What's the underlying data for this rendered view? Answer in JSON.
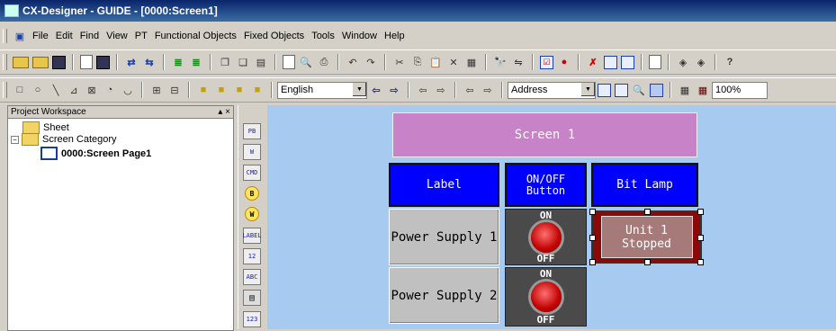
{
  "window": {
    "title": "CX-Designer - GUIDE - [0000:Screen1]"
  },
  "menu": [
    "File",
    "Edit",
    "Find",
    "View",
    "PT",
    "Functional Objects",
    "Fixed Objects",
    "Tools",
    "Window",
    "Help"
  ],
  "toolbar2": {
    "language_value": "English",
    "address_value": "Address",
    "zoom_value": "100%"
  },
  "workspace": {
    "title": "Project Workspace",
    "controls": "▴ ×",
    "tree": [
      {
        "label": "Sheet"
      },
      {
        "label": "Screen Category",
        "expander": "−"
      },
      {
        "label": "0000:Screen Page1",
        "selected": true
      }
    ]
  },
  "palette_icons": [
    "PB",
    "W",
    "CMD",
    "B",
    "W",
    "LABEL",
    "12",
    "ABC",
    "list",
    "123"
  ],
  "screen": {
    "title_banner": "Screen 1",
    "headers": [
      "Label",
      "ON/OFF\nButton",
      "Bit Lamp"
    ],
    "rows": [
      {
        "label": "Power Supply 1",
        "toggle_on": "ON",
        "toggle_off": "OFF",
        "lamp": "Unit 1 Stopped"
      },
      {
        "label": "Power Supply 2",
        "toggle_on": "ON",
        "toggle_off": "OFF"
      }
    ],
    "colors": {
      "canvas": "#a6caf0",
      "header": "#0000ff",
      "banner": "#c882c8",
      "lamp": "#8a0a0a"
    }
  }
}
